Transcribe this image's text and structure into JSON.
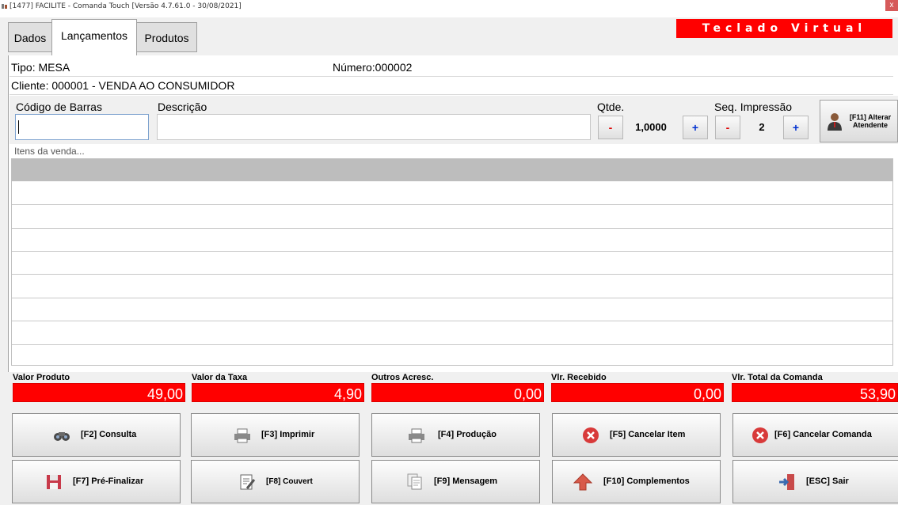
{
  "window": {
    "title": "[1477] FACILITE - Comanda Touch [Versão 4.7.61.0 - 30/08/2021]",
    "close_label": "x"
  },
  "tabs": [
    {
      "label": "Dados",
      "active": false
    },
    {
      "label": "Lançamentos",
      "active": true
    },
    {
      "label": "Produtos",
      "active": false
    }
  ],
  "teclado_virtual": "Teclado Virtual",
  "info": {
    "tipo": "Tipo: MESA",
    "numero": "Número:000002",
    "cliente": "Cliente: 000001 - VENDA AO CONSUMIDOR"
  },
  "entry": {
    "codigo_label": "Código de Barras",
    "codigo_value": "",
    "descricao_label": "Descrição",
    "descricao_value": "",
    "qtde_label": "Qtde.",
    "qtde_value": "1,0000",
    "seq_label": "Seq. Impressão",
    "seq_value": "2",
    "minus": "-",
    "plus": "+"
  },
  "atendente_button": "[F11] Alterar Atendente",
  "items_label": "Itens da venda...",
  "items": [],
  "totals": [
    {
      "label": "Valor Produto",
      "value": "49,00"
    },
    {
      "label": "Valor da Taxa",
      "value": "4,90"
    },
    {
      "label": "Outros Acresc.",
      "value": "0,00"
    },
    {
      "label": "Vlr. Recebido",
      "value": "0,00"
    },
    {
      "label": "Vlr. Total da Comanda",
      "value": "53,90"
    }
  ],
  "buttons_row1": [
    {
      "label": "[F2] Consulta",
      "icon": "binoculars-icon"
    },
    {
      "label": "[F3] Imprimir",
      "icon": "printer-icon"
    },
    {
      "label": "[F4] Produção",
      "icon": "printer-icon"
    },
    {
      "label": "[F5] Cancelar Item",
      "icon": "cancel-icon"
    },
    {
      "label": "[F6] Cancelar Comanda",
      "icon": "cancel-icon"
    }
  ],
  "buttons_row2": [
    {
      "label": "[F7] Pré-Finalizar",
      "icon": "floppy-icon"
    },
    {
      "label": "[F8] Couvert",
      "icon": "edit-note-icon"
    },
    {
      "label": "[F9] Mensagem",
      "icon": "documents-icon"
    },
    {
      "label": "[F10] Complementos",
      "icon": "arrow-up-icon"
    },
    {
      "label": "[ESC] Sair",
      "icon": "exit-door-icon"
    }
  ],
  "colors": {
    "accent_red": "#ff0000",
    "window_bg": "#f0f0f0",
    "grid_header": "#bdbdbd"
  }
}
